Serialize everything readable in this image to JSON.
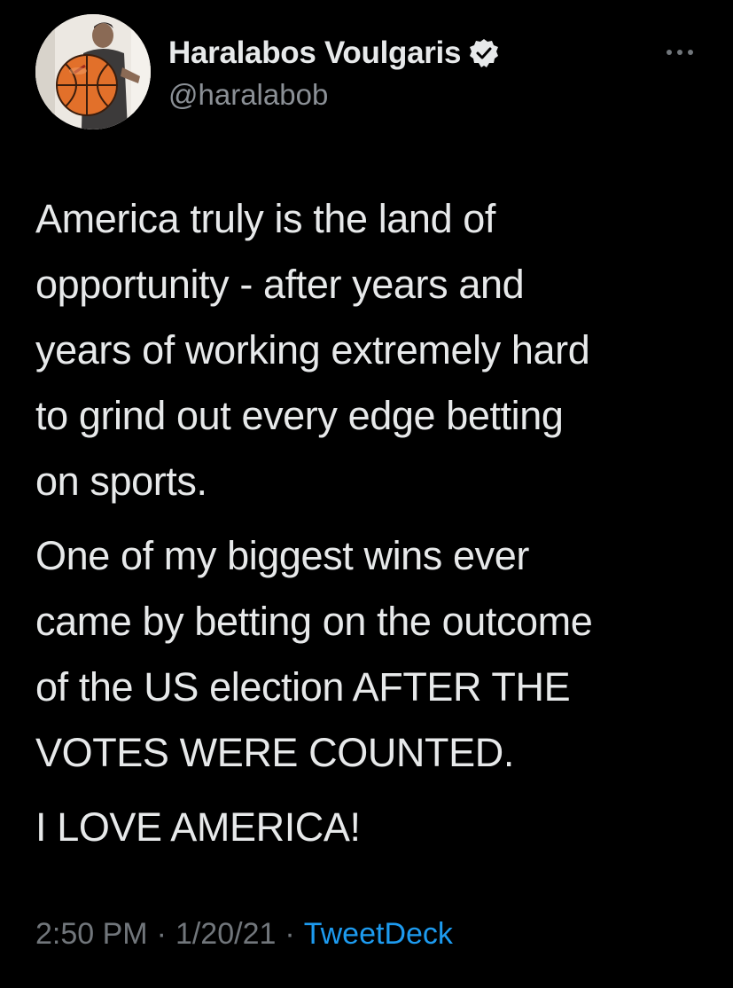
{
  "author": {
    "display_name": "Haralabos Voulgaris",
    "handle": "@haralabob",
    "verified": true,
    "avatar_icon": "avatar-basketball-photo",
    "verified_icon": "verified-badge-icon",
    "more_icon": "more-options-icon"
  },
  "tweet": {
    "paragraphs": [
      "America truly is the land of\nopportunity - after years and\nyears of working extremely hard\nto grind out every edge betting\non sports.",
      "One of my biggest wins ever\ncame by betting on the outcome\nof the US election AFTER THE\nVOTES WERE COUNTED.",
      "I LOVE AMERICA!"
    ],
    "time": "2:50 PM",
    "date": "1/20/21",
    "separator": "·",
    "source": "TweetDeck"
  },
  "colors": {
    "background": "#000000",
    "text": "#e7e9ea",
    "secondary": "#71767b",
    "link": "#1d9bf0"
  }
}
